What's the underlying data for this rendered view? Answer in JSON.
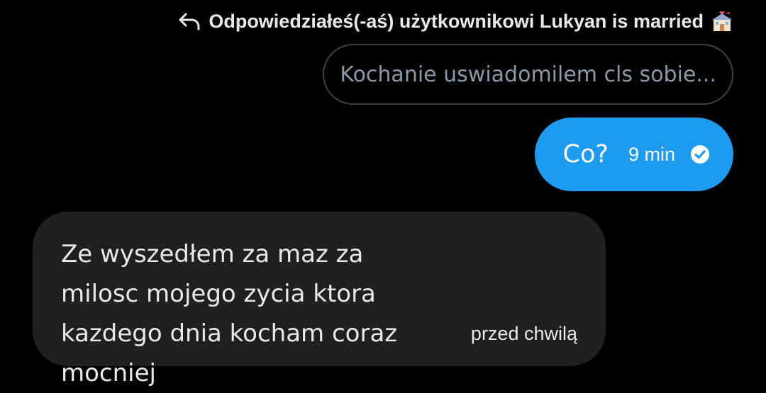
{
  "reply_context": {
    "label": "Odpowiedziałeś(-aś) użytkownikowi Lukyan is married",
    "icon": "reply-icon",
    "emoji_icon": "wedding-icon"
  },
  "quoted_message": {
    "text": "Kochanie uswiadomilem cls sobie..."
  },
  "sent_message": {
    "text": "Co?",
    "time": "9 min",
    "status_icon": "check-circle-icon",
    "bubble_color": "#1d9bf0"
  },
  "received_message": {
    "text": "Ze wyszedłem za maz za milosc mojego zycia ktora kazdego dnia kocham coraz mocniej",
    "time": "przed chwilą",
    "bubble_color": "#1f2021"
  }
}
